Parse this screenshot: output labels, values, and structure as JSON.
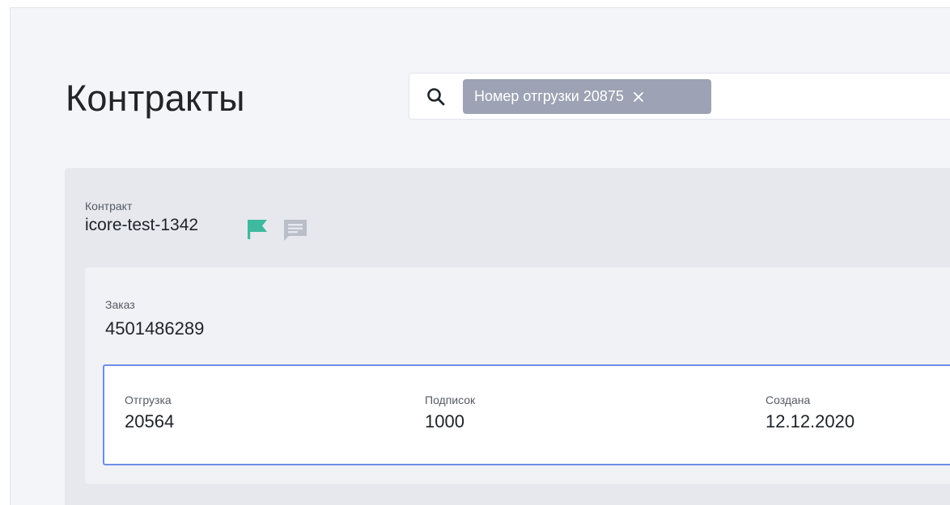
{
  "page": {
    "title": "Контракты"
  },
  "search": {
    "chip_label": "Номер отгрузки",
    "chip_value": "20875"
  },
  "contract": {
    "label": "Контракт",
    "id": "icore-test-1342",
    "flag_color": "#3fb99f",
    "comment_icon_color": "#b9bec9",
    "order": {
      "label": "Заказ",
      "number": "4501486289",
      "shipment": {
        "shipment_label": "Отгрузка",
        "shipment_value": "20564",
        "subscriptions_label": "Подписок",
        "subscriptions_value": "1000",
        "created_label": "Создана",
        "created_value": "12.12.2020",
        "border_color": "#6c8de8"
      }
    }
  },
  "icons": [
    "search-icon",
    "close-icon",
    "flag-icon",
    "comment-icon"
  ]
}
